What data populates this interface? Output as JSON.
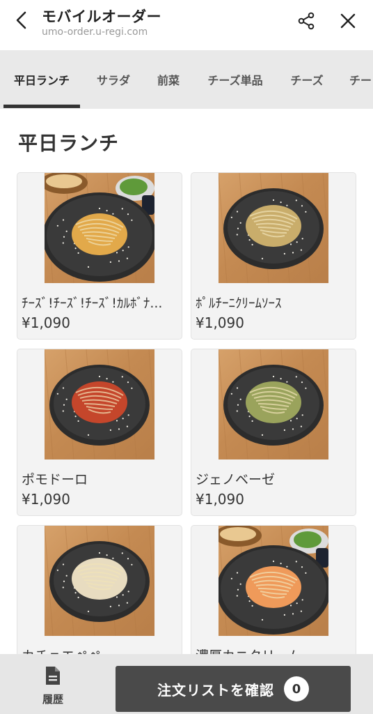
{
  "header": {
    "title": "モバイルオーダー",
    "url": "umo-order.u-regi.com"
  },
  "tabs": [
    {
      "label": "平日ランチ",
      "active": true
    },
    {
      "label": "サラダ",
      "active": false
    },
    {
      "label": "前菜",
      "active": false
    },
    {
      "label": "チーズ単品",
      "active": false
    },
    {
      "label": "チーズ",
      "active": false
    },
    {
      "label": "チー",
      "active": false
    }
  ],
  "section": {
    "title": "平日ランチ"
  },
  "items": [
    {
      "name": "ﾁｰｽﾞ!ﾁｰｽﾞ!ﾁｰｽﾞ!ｶﾙﾎﾞﾅ...",
      "price": "¥1,090",
      "sauce": "#e2a94a",
      "has_salad": true
    },
    {
      "name": "ﾎﾟﾙﾁｰﾆｸﾘｰﾑｿｰｽ",
      "price": "¥1,090",
      "sauce": "#c9ad6b",
      "has_salad": false
    },
    {
      "name": "ポモドーロ",
      "price": "¥1,090",
      "sauce": "#c5462b",
      "has_salad": false
    },
    {
      "name": "ジェノベーゼ",
      "price": "¥1,090",
      "sauce": "#9aa35c",
      "has_salad": false
    },
    {
      "name": "カチョエペペ",
      "price": "",
      "sauce": "#e8dcc0",
      "has_salad": false
    },
    {
      "name": "濃厚カニクリーム",
      "price": "",
      "sauce": "#ef9a5a",
      "has_salad": true
    }
  ],
  "bottom": {
    "history_label": "履歴",
    "order_label": "注文リストを確認",
    "order_count": "0"
  },
  "colors": {
    "tab_bar": "#e9e9e9",
    "order_button": "#4a4a4a",
    "bottom_bar": "#e6e6e6"
  }
}
